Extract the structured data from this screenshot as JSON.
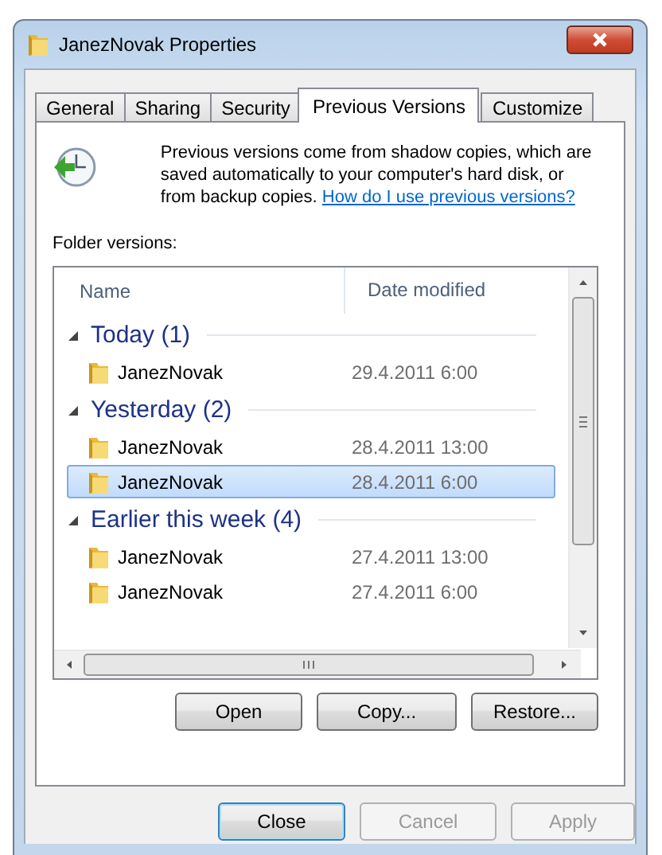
{
  "window": {
    "title": "JanezNovak Properties"
  },
  "tabs": [
    {
      "label": "General",
      "selected": false
    },
    {
      "label": "Sharing",
      "selected": false
    },
    {
      "label": "Security",
      "selected": false
    },
    {
      "label": "Previous Versions",
      "selected": true
    },
    {
      "label": "Customize",
      "selected": false
    }
  ],
  "info": {
    "text": "Previous versions come from shadow copies, which are saved automatically to your computer's hard disk, or from backup copies.",
    "link": "How do I use previous versions?"
  },
  "versions_label": "Folder versions:",
  "list": {
    "columns": [
      "Name",
      "Date modified"
    ],
    "groups": [
      {
        "title": "Today (1)",
        "expanded": true,
        "items": [
          {
            "name": "JanezNovak",
            "date": "29.4.2011 6:00",
            "selected": false
          }
        ]
      },
      {
        "title": "Yesterday (2)",
        "expanded": true,
        "items": [
          {
            "name": "JanezNovak",
            "date": "28.4.2011 13:00",
            "selected": false
          },
          {
            "name": "JanezNovak",
            "date": "28.4.2011 6:00",
            "selected": true
          }
        ]
      },
      {
        "title": "Earlier this week (4)",
        "expanded": true,
        "items": [
          {
            "name": "JanezNovak",
            "date": "27.4.2011 13:00",
            "selected": false
          },
          {
            "name": "JanezNovak",
            "date": "27.4.2011 6:00",
            "selected": false
          }
        ]
      }
    ]
  },
  "actions": [
    "Open",
    "Copy...",
    "Restore..."
  ],
  "buttons": [
    {
      "label": "Close",
      "default": true,
      "disabled": false
    },
    {
      "label": "Cancel",
      "default": false,
      "disabled": true
    },
    {
      "label": "Apply",
      "default": false,
      "disabled": true
    }
  ]
}
